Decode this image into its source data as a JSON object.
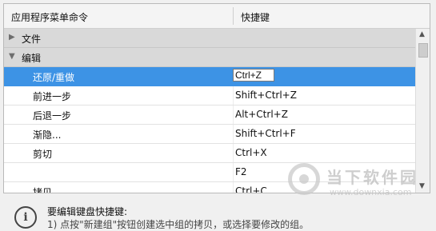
{
  "table": {
    "header": {
      "col1": "应用程序菜单命令",
      "col2": "快捷键"
    },
    "rows": [
      {
        "type": "group",
        "expanded": false,
        "label": "文件"
      },
      {
        "type": "group",
        "expanded": true,
        "label": "编辑"
      },
      {
        "type": "item",
        "label": "还原/重做",
        "shortcut": "Ctrl+Z",
        "selected": true
      },
      {
        "type": "item",
        "label": "前进一步",
        "shortcut": "Shift+Ctrl+Z"
      },
      {
        "type": "item",
        "label": "后退一步",
        "shortcut": "Alt+Ctrl+Z"
      },
      {
        "type": "item",
        "label": "渐隐...",
        "shortcut": "Shift+Ctrl+F"
      },
      {
        "type": "item",
        "label": "剪切",
        "shortcut": "Ctrl+X"
      },
      {
        "type": "item",
        "label": "",
        "shortcut": "F2"
      },
      {
        "type": "item",
        "label": "拷贝",
        "shortcut": "Ctrl+C"
      }
    ]
  },
  "info": {
    "icon": "info-icon",
    "title": "要编辑键盘快捷键:",
    "line2": "1) 点按\"新建组\"按钮创建选中组的拷贝，或选择要修改的组。"
  },
  "watermark": {
    "name": "当下软件园",
    "url": "www.downxia.com"
  },
  "colors": {
    "selected": "#3d93e5",
    "group_bg": "#d9d9d9"
  }
}
